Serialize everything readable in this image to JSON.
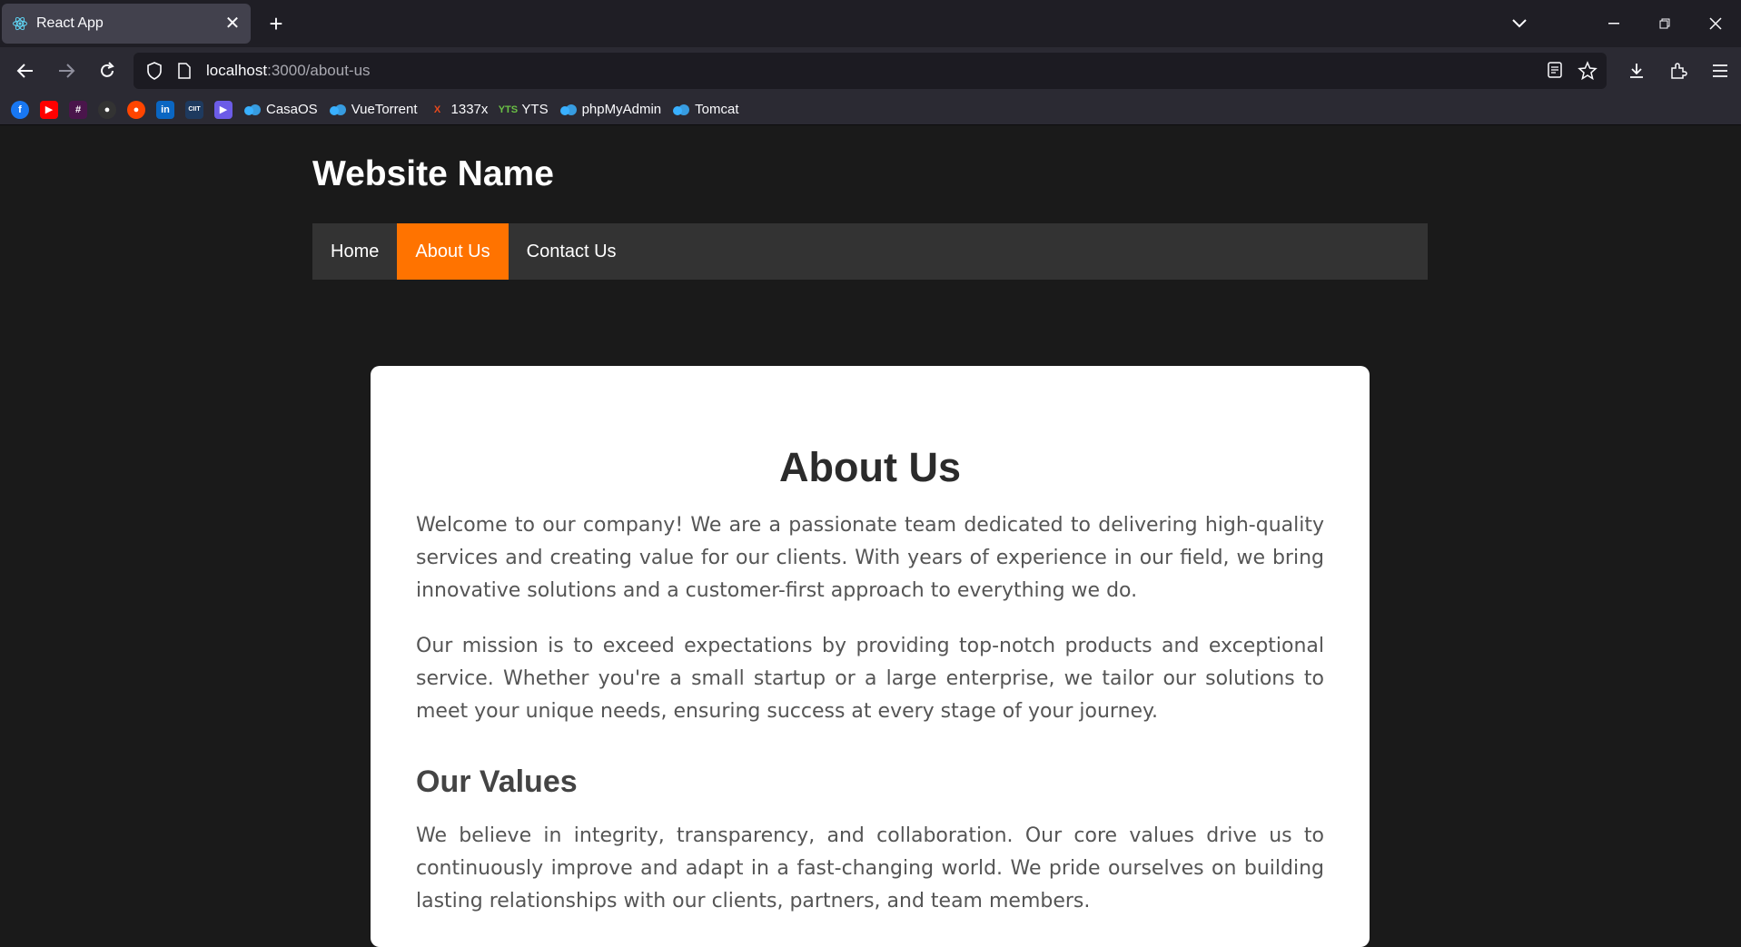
{
  "browser": {
    "tab_title": "React App",
    "url_host": "localhost",
    "url_rest": ":3000/about-us",
    "bookmarks": [
      {
        "label": "",
        "icon": "facebook-icon",
        "color": "#1877f2",
        "glyph": "f"
      },
      {
        "label": "",
        "icon": "youtube-icon",
        "color": "#ff0000",
        "glyph": "▶"
      },
      {
        "label": "",
        "icon": "slack-icon",
        "color": "#4a154b",
        "glyph": "#"
      },
      {
        "label": "",
        "icon": "github-icon",
        "color": "#333333",
        "glyph": "●"
      },
      {
        "label": "",
        "icon": "reddit-icon",
        "color": "#ff4500",
        "glyph": "●"
      },
      {
        "label": "",
        "icon": "linkedin-icon",
        "color": "#0a66c2",
        "glyph": "in"
      },
      {
        "label": "",
        "icon": "citt-icon",
        "color": "#1e3a5f",
        "glyph": "CIIT"
      },
      {
        "label": "",
        "icon": "play-diamond-icon",
        "color": "#6c5ce7",
        "glyph": "▶"
      },
      {
        "label": "CasaOS",
        "icon": "cloud-icon",
        "color": "#39b0ff",
        "glyph": ""
      },
      {
        "label": "VueTorrent",
        "icon": "cloud-icon",
        "color": "#39b0ff",
        "glyph": ""
      },
      {
        "label": "1337x",
        "icon": "x-icon",
        "color": "#e8491d",
        "glyph": "X"
      },
      {
        "label": "YTS",
        "icon": "yts-icon",
        "color": "#6ac045",
        "glyph": "YTS"
      },
      {
        "label": "phpMyAdmin",
        "icon": "cloud-icon",
        "color": "#39b0ff",
        "glyph": ""
      },
      {
        "label": "Tomcat",
        "icon": "cloud-icon",
        "color": "#39b0ff",
        "glyph": ""
      }
    ]
  },
  "site": {
    "title": "Website Name",
    "nav": [
      {
        "label": "Home",
        "active": false
      },
      {
        "label": "About Us",
        "active": true
      },
      {
        "label": "Contact Us",
        "active": false
      }
    ],
    "accent": "#ff7300"
  },
  "content": {
    "heading": "About Us",
    "p1": "Welcome to our company! We are a passionate team dedicated to delivering high-quality services and creating value for our clients. With years of experience in our field, we bring innovative solutions and a customer-first approach to everything we do.",
    "p2": "Our mission is to exceed expectations by providing top-notch products and exceptional service. Whether you're a small startup or a large enterprise, we tailor our solutions to meet your unique needs, ensuring success at every stage of your journey.",
    "values_heading": "Our Values",
    "p3": "We believe in integrity, transparency, and collaboration. Our core values drive us to continuously improve and adapt in a fast-changing world. We pride ourselves on building lasting relationships with our clients, partners, and team members."
  }
}
